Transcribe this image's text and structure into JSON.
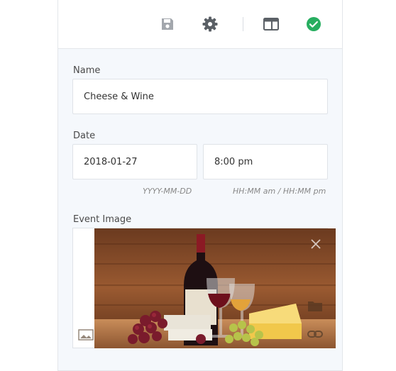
{
  "toolbar": {
    "icons": [
      "save-icon",
      "gear-icon",
      "layout-icon",
      "check-circle-icon"
    ],
    "accent": "#27ae60"
  },
  "form": {
    "name": {
      "label": "Name",
      "value": "Cheese & Wine"
    },
    "date": {
      "label": "Date",
      "date_value": "2018-01-27",
      "time_value": "8:00 pm",
      "date_hint": "YYYY-MM-DD",
      "time_hint": "HH:MM am / HH:MM pm"
    },
    "image": {
      "label": "Event Image"
    }
  }
}
